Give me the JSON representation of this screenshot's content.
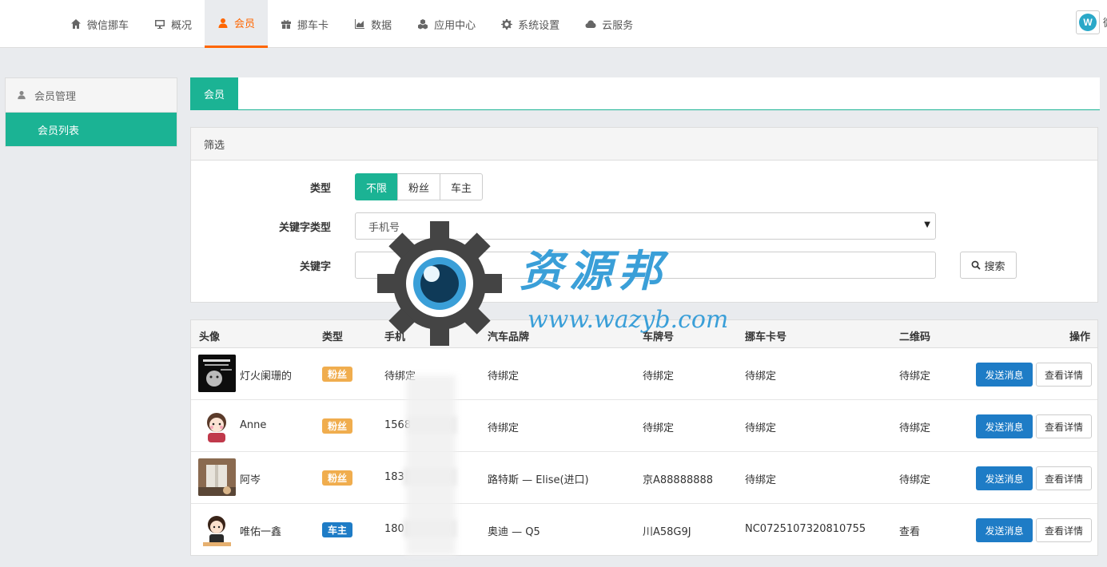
{
  "nav": {
    "items": [
      {
        "label": "微信挪车",
        "icon": "home-icon"
      },
      {
        "label": "概况",
        "icon": "desktop-icon"
      },
      {
        "label": "会员",
        "icon": "user-icon",
        "active": true
      },
      {
        "label": "挪车卡",
        "icon": "gift-icon"
      },
      {
        "label": "数据",
        "icon": "area-chart-icon"
      },
      {
        "label": "应用中心",
        "icon": "cubes-icon"
      },
      {
        "label": "系统设置",
        "icon": "gear-icon"
      },
      {
        "label": "云服务",
        "icon": "cloud-icon"
      }
    ],
    "user_name_partial": "微"
  },
  "sidebar": {
    "header": "会员管理",
    "items": [
      {
        "label": "会员列表"
      }
    ]
  },
  "tab": {
    "label": "会员"
  },
  "filter": {
    "title": "筛选",
    "type_label": "类型",
    "type_options": [
      "不限",
      "粉丝",
      "车主"
    ],
    "type_selected": "不限",
    "keyword_type_label": "关键字类型",
    "keyword_type_value": "手机号",
    "keyword_label": "关键字",
    "keyword_value": "",
    "search_label": "搜索"
  },
  "table": {
    "headers": [
      "头像",
      "类型",
      "手机",
      "汽车品牌",
      "车牌号",
      "挪车卡号",
      "二维码",
      "操作"
    ],
    "rows": [
      {
        "name": "灯火阑珊的",
        "type": "粉丝",
        "phone": "待绑定",
        "brand": "待绑定",
        "plate": "待绑定",
        "card": "待绑定",
        "qrcode": "待绑定",
        "qr_link": false
      },
      {
        "name": "Anne",
        "type": "粉丝",
        "phone": "1568",
        "brand": "待绑定",
        "plate": "待绑定",
        "card": "待绑定",
        "qrcode": "待绑定",
        "qr_link": false
      },
      {
        "name": "阿岑",
        "type": "粉丝",
        "phone": "183",
        "brand": "路特斯 — Elise(进口)",
        "plate": "京A88888888",
        "card": "待绑定",
        "qrcode": "待绑定",
        "qr_link": false
      },
      {
        "name": "唯佑一鑫",
        "type": "车主",
        "phone": "180",
        "brand": "奥迪 — Q5",
        "plate": "川A58G9J",
        "card": "NC0725107320810755",
        "qrcode": "查看",
        "qr_link": true
      }
    ],
    "send_label": "发送消息",
    "detail_label": "查看详情"
  },
  "watermark": {
    "title": "资源邦",
    "url": "www.wazyb.com"
  },
  "colors": {
    "accent": "#1bb394",
    "nav_active": "#ff6600",
    "primary_button": "#1e7cc6",
    "fan_badge": "#f0ad4e"
  }
}
